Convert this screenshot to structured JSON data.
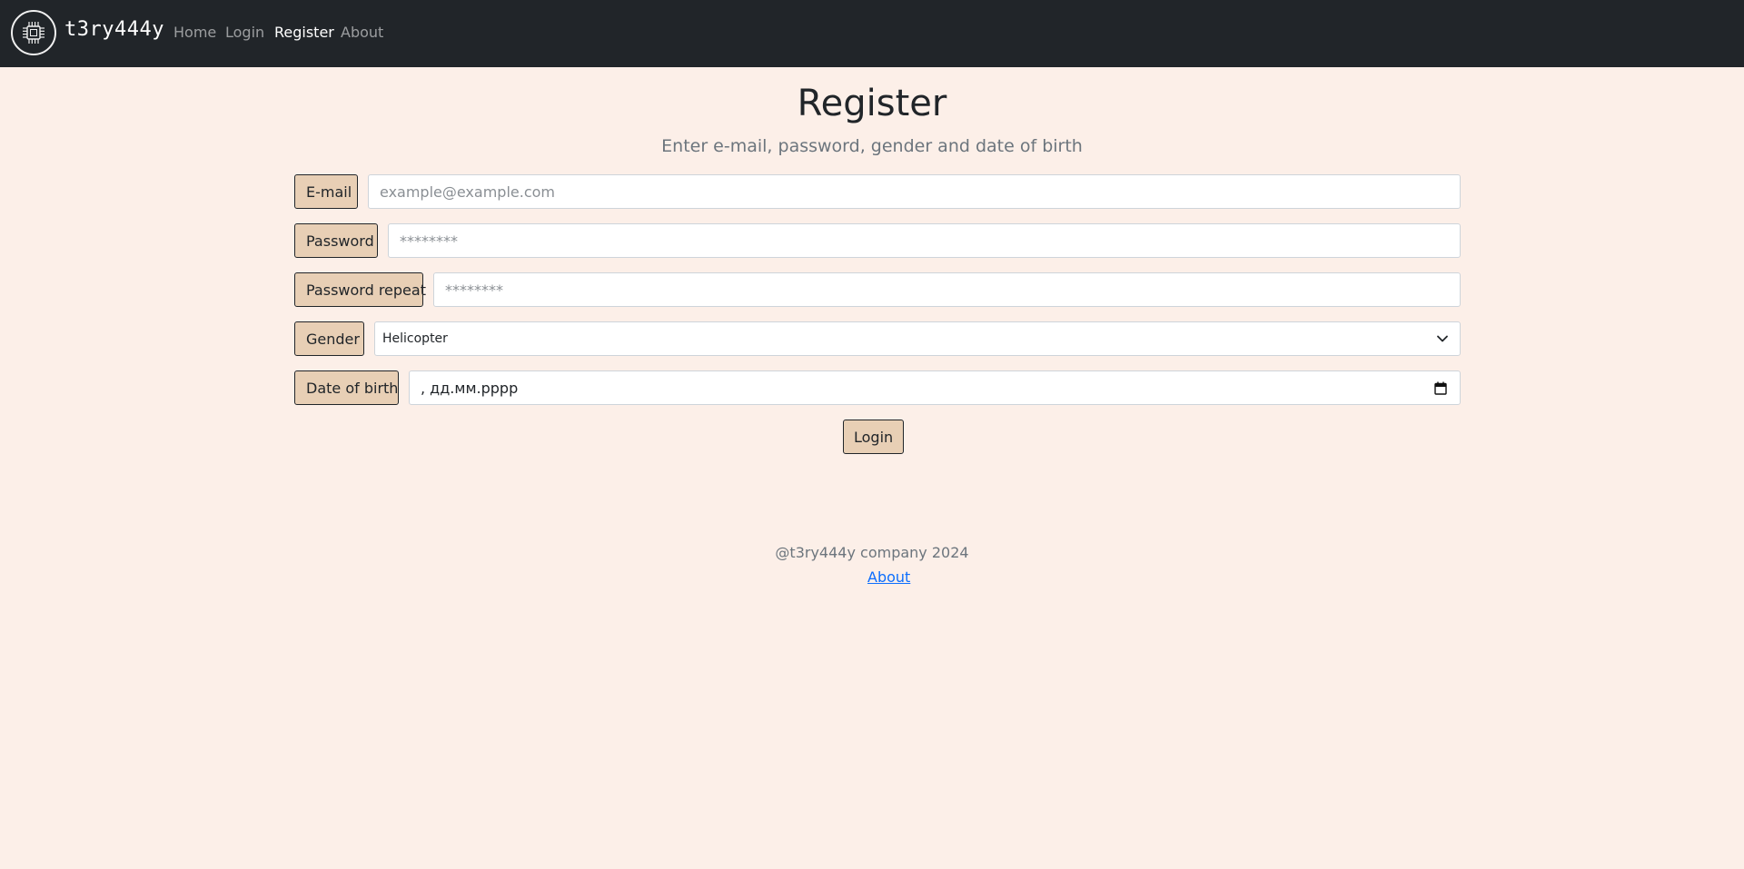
{
  "navbar": {
    "brand": "t3ry444y",
    "logo_icon": "chip-icon",
    "links": [
      {
        "label": "Home",
        "active": false
      },
      {
        "label": "Login",
        "active": false
      },
      {
        "label": "Register",
        "active": true
      },
      {
        "label": "About",
        "active": false
      }
    ]
  },
  "main": {
    "title": "Register",
    "subtitle": "Enter e-mail, password, gender and date of birth",
    "fields": {
      "email": {
        "label": "E-mail",
        "placeholder": "example@example.com",
        "value": ""
      },
      "password": {
        "label": "Password",
        "placeholder": "********",
        "value": ""
      },
      "password_repeat": {
        "label": "Password repeat",
        "placeholder": "********",
        "value": ""
      },
      "gender": {
        "label": "Gender",
        "selected": "Helicopter"
      },
      "dob": {
        "label": "Date of birth",
        "value": ", дд.мм.рррр"
      }
    },
    "submit_label": "Login"
  },
  "footer": {
    "text": "@t3ry444y company 2024",
    "link": "About"
  },
  "colors": {
    "background": "#fcefe8",
    "navbar": "#212529",
    "label_bg": "#e8cfb5",
    "link": "#0d6efd"
  }
}
